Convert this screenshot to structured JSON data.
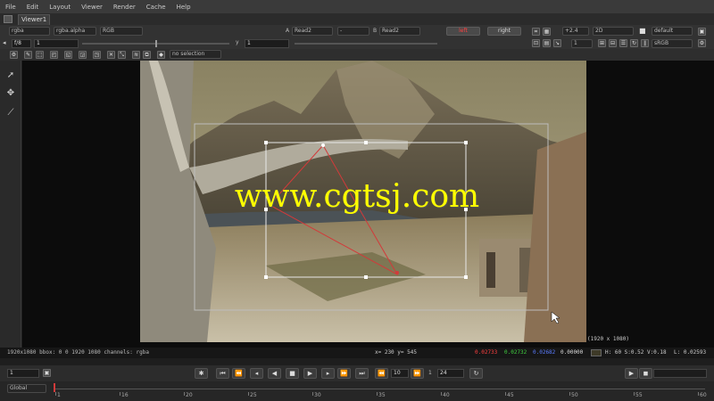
{
  "menu": [
    "File",
    "Edit",
    "Layout",
    "Viewer",
    "Render",
    "Cache",
    "Help"
  ],
  "tab": {
    "label": "Viewer1"
  },
  "toolbar1": {
    "layer": "rgba",
    "channel": "rgba.alpha",
    "display": "RGB",
    "a_label": "A",
    "a_input": "Read2",
    "compare": "-",
    "b_label": "B",
    "b_input": "Read2",
    "left_btn": "left",
    "right_btn": "right",
    "gain": "+2.4",
    "view_mode": "2D",
    "lut": "default"
  },
  "toolbar2": {
    "frame_range": "f/8",
    "frame": "1",
    "y_label": "y",
    "y_value": "1",
    "proxy": "1",
    "colorspace": "sRGB"
  },
  "toolbar3": {
    "transform_mode": "no selection"
  },
  "status": {
    "format": "1920x1080 bbox: 0 0 1920 1080 channels: rgba",
    "coords": "x= 230 y= 545",
    "r": "0.02733",
    "g": "0.02732",
    "b": "0.02682",
    "a": "0.00000",
    "hsv": "H: 60 S:0.52 V:0.18",
    "luma": "L: 0.02593",
    "resolution_badge": "(1920 x 1080)"
  },
  "transport": {
    "frame_field": "1",
    "current_frame": "10",
    "step": "1",
    "end_frame_label": "1",
    "end_frame": "24",
    "playback_mode": "Global"
  },
  "timeline": {
    "ticks": [
      "1",
      "16",
      "20",
      "25",
      "30",
      "35",
      "40",
      "45",
      "50",
      "55",
      "60"
    ],
    "current": 1
  },
  "viewer": {
    "watermark": "www.cgtsj.com"
  },
  "colors": {
    "accent_red": "#d23a3a",
    "r_text": "#ff4040",
    "g_text": "#40d040",
    "b_text": "#5a7cff",
    "watermark": "#ffff00",
    "menubar": "#3a3a3a"
  }
}
